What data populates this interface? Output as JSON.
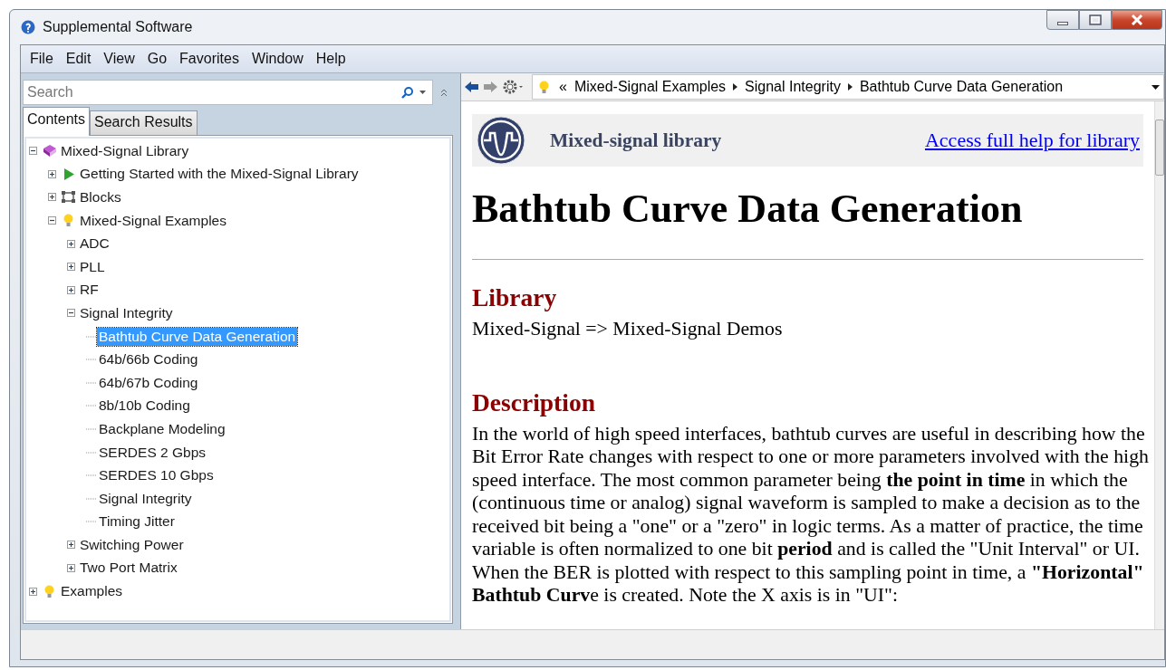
{
  "window": {
    "title": "Supplemental Software"
  },
  "menu": [
    "File",
    "Edit",
    "View",
    "Go",
    "Favorites",
    "Window",
    "Help"
  ],
  "search": {
    "placeholder": "Search"
  },
  "tabs": [
    {
      "label": "Contents",
      "selected": true
    },
    {
      "label": "Search Results",
      "selected": false
    }
  ],
  "tree": [
    {
      "label": "Mixed-Signal Library",
      "kind": "book",
      "expanded": true,
      "selected": false,
      "children": [
        {
          "label": "Getting Started with the Mixed-Signal Library",
          "kind": "play",
          "expanded": false,
          "selected": false
        },
        {
          "label": "Blocks",
          "kind": "blocks",
          "expanded": false,
          "selected": false
        },
        {
          "label": "Mixed-Signal Examples",
          "kind": "bulb",
          "expanded": true,
          "selected": false,
          "children": [
            {
              "label": "ADC",
              "expanded": false,
              "selected": false
            },
            {
              "label": "PLL",
              "expanded": false,
              "selected": false
            },
            {
              "label": "RF",
              "expanded": false,
              "selected": false
            },
            {
              "label": "Signal Integrity",
              "expanded": true,
              "selected": false,
              "children": [
                {
                  "label": "Bathtub Curve Data Generation",
                  "selected": true
                },
                {
                  "label": "64b/66b Coding",
                  "selected": false
                },
                {
                  "label": "64b/67b Coding",
                  "selected": false
                },
                {
                  "label": "8b/10b Coding",
                  "selected": false
                },
                {
                  "label": "Backplane Modeling",
                  "selected": false
                },
                {
                  "label": "SERDES 2 Gbps",
                  "selected": false
                },
                {
                  "label": "SERDES 10 Gbps",
                  "selected": false
                },
                {
                  "label": "Signal Integrity",
                  "selected": false
                },
                {
                  "label": "Timing Jitter",
                  "selected": false
                }
              ]
            },
            {
              "label": "Switching Power",
              "expanded": false,
              "selected": false
            },
            {
              "label": "Two Port Matrix",
              "expanded": false,
              "selected": false
            }
          ]
        }
      ]
    },
    {
      "label": "Examples",
      "kind": "bulb",
      "expanded": false,
      "selected": false
    }
  ],
  "breadcrumb": {
    "lead": "«",
    "items": [
      "Mixed-Signal Examples",
      "Signal Integrity",
      "Bathtub Curve Data Generation"
    ]
  },
  "page": {
    "banner_title": "Mixed-signal library",
    "banner_link": "Access full help for library",
    "title": "Bathtub Curve Data Generation",
    "sections": [
      {
        "heading": "Library",
        "text": "Mixed-Signal => Mixed-Signal Demos"
      },
      {
        "heading": "Description",
        "text": "In the world of high speed interfaces, bathtub curves are useful in describing how the Bit Error Rate changes with respect to one or more parameters involved with the high speed interface. The most common parameter being **the point in time** in which the (continuous time or analog) signal waveform is sampled to make a decision as to the received bit being a \"one\" or a \"zero\" in logic terms. As a matter of practice, the time variable is often normalized to one bit **period** and is called the \"Unit Interval\" or UI. When the BER is plotted with respect to this sampling point in time, a **\"Horizontal\" Bathtub Curv**e is created. Note the X axis is in \"UI\":"
      }
    ]
  }
}
